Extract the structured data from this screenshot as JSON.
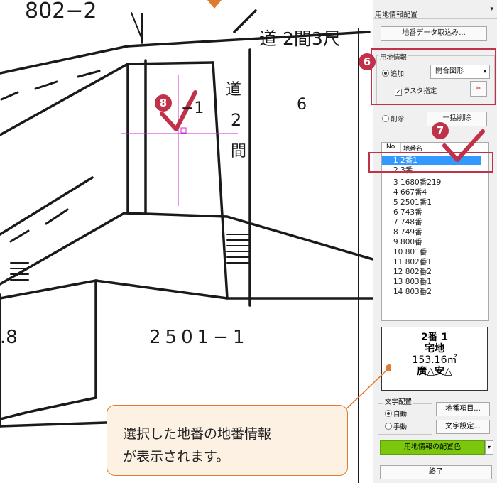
{
  "map": {
    "texts": {
      "parcel_top": "802−2",
      "road_label_top": "道 2間3尺",
      "road_label_vertical": "道",
      "parcel_minus1": "−1",
      "parcel_6": "6",
      "parcel_2": "2",
      "kan": "間",
      "parcel_8": ".8",
      "parcel_bottom": "2501−1"
    }
  },
  "panel": {
    "title": "用地情報配置",
    "import_button": "地番データ取込み...",
    "land_info_group": "用地情報",
    "add_radio": "追加",
    "shape_select": "閉合図形",
    "raster_check": "ラスタ指定",
    "delete_radio": "削除",
    "bulk_delete_button": "一括削除",
    "list_header_no": "No",
    "list_header_name": "地番名",
    "list_items": [
      "1 2番1",
      "2 3番",
      "3 1680番219",
      "4 667番4",
      "5 2501番1",
      "6 743番",
      "7 748番",
      "8 749番",
      "9 800番",
      "10 801番",
      "11 802番1",
      "12 802番2",
      "13 803番1",
      "14 803番2"
    ],
    "info": {
      "lot": "2番 1",
      "land_use": "宅地",
      "area": "153.16㎡",
      "owner": "廣△安△"
    },
    "text_layout_group": "文字配置",
    "auto_radio": "自動",
    "manual_radio": "手動",
    "lot_items_button": "地番項目...",
    "text_settings_button": "文字設定...",
    "color_button": "用地情報の配置色",
    "end_button": "終了"
  },
  "badges": {
    "b6": "6",
    "b7": "7",
    "b8": "8"
  },
  "callout": {
    "line1": "選択した地番の地番情報",
    "line2": "が表示されます。"
  },
  "colors": {
    "accent_red": "#c0314a",
    "callout_border": "#e07a30",
    "callout_bg": "#fdf1e4",
    "selection_blue": "#3399ff",
    "color_button_green": "#7ac70c",
    "crosshair_magenta": "#d12ad1"
  }
}
